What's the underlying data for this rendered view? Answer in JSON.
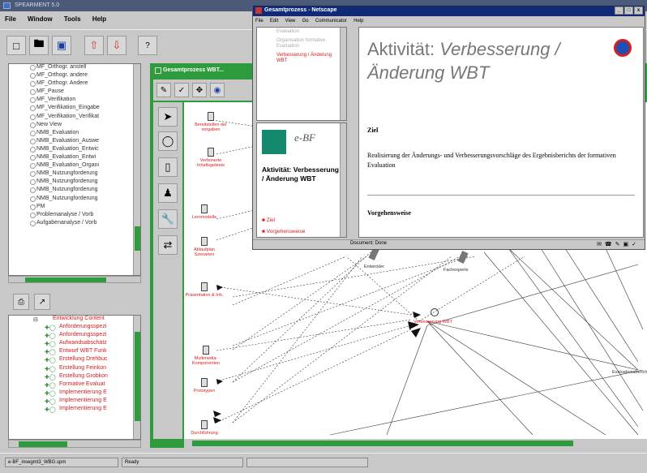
{
  "app": {
    "title": "SPEARMENT 5.0"
  },
  "menu": [
    "File",
    "Window",
    "Tools",
    "Help"
  ],
  "toolbar": {
    "help_label": "?"
  },
  "tree_top": {
    "items": [
      "MF_Orthogr. anstell",
      "MF_Orthogr. andere",
      "MF_Orthogr. Andere",
      "MF_Pause",
      "MF_Verifikation",
      "MF_Verifikation_Eingabe",
      "MF_Verifikation_Verifikat",
      "New View",
      "NMB_Evaluation",
      "NMB_Evaluation_Auswe",
      "NMB_Evaluation_Entwic",
      "NMB_Evaluation_Entwi",
      "NMB_Evaluation_Organi",
      "NMB_Nutzungforderung",
      "NMB_Nutzungforderung",
      "NMB_Nutzungforderung",
      "NMB_Nutzungforderung",
      "PM",
      "Problemanalyse / Vorb",
      "Aufgabenanalyse / Vorb"
    ]
  },
  "tree_bottom": {
    "root": "Entwicklung Content",
    "items": [
      "Anforderungsspezi",
      "Anforderungsspezi",
      "Aufwandsabschätz",
      "Entwurf WBT Funk",
      "Erstellung Drehbuc",
      "Erstellung Feinkon",
      "Erstellung Grobkon",
      "Formative Evaluat",
      "Implementierung E",
      "Implementierung E",
      "Implementierung E"
    ]
  },
  "inner_window": {
    "title": "Gesamtprozess WBT..."
  },
  "canvas": {
    "nodes": [
      "Bereitstellen der vorgaben",
      "Verfeinerte Inhaltsgebiete",
      "Lernmodelle",
      "Ablaufplan Szenarien",
      "Präsentation & Inh.",
      "Multimedia-Komponenten",
      "Prototypen",
      "Durchführung"
    ],
    "center_node": "Verbesserung WBT",
    "role_labels": [
      "Entwickler",
      "Fachexperte"
    ],
    "edge_label_right": "Evaluationsbericht"
  },
  "netscape": {
    "title": "Gesamtprozess - Netscape",
    "menu": [
      "File",
      "Edit",
      "View",
      "Go",
      "Communicator",
      "Help"
    ],
    "nav_items_gray": [
      "Evaluation",
      "Organisation formative Evaluation"
    ],
    "nav_item_active": "Verbesserung / Änderung WBT",
    "logo_text": "e-BF",
    "activity_small": "Aktivität: Verbesserung / Änderung WBT",
    "links": [
      "Ziel",
      "Vorgehensweise"
    ],
    "heading_prefix": "Aktivität:",
    "heading_main": "Verbesserung /",
    "heading_line2": "Änderung WBT",
    "ziel_label": "Ziel",
    "description": "Realisierung der Änderungs- und Verbesserungsvorschläge des Ergebnisberichts der formativen Evaluation",
    "vorgehen_label": "Vorgehensweise",
    "status": "Document: Done"
  },
  "statusbar": {
    "file": "e-BF_insegmt3_WBG.spm",
    "state": "Ready"
  }
}
